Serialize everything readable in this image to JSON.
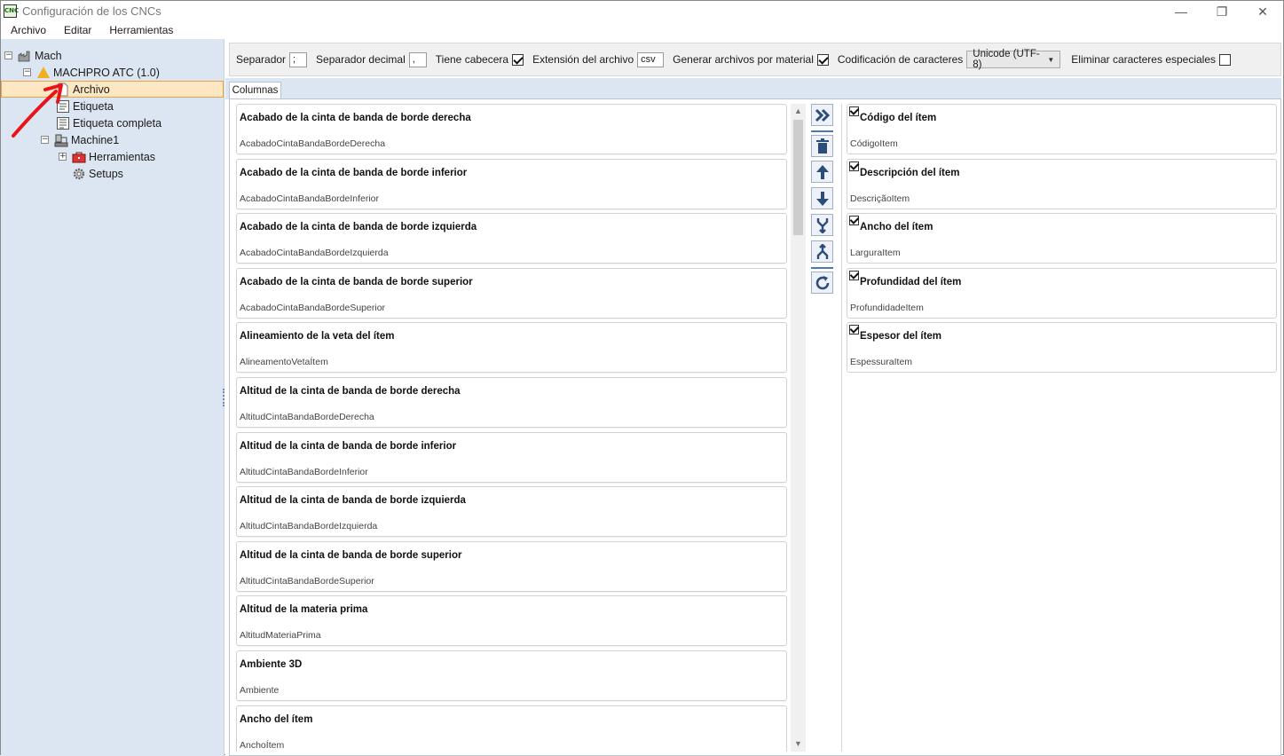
{
  "window": {
    "app_icon_text": "CNC",
    "title": "Configuración de los CNCs",
    "minimize_glyph": "—",
    "restore_glyph": "❐",
    "close_glyph": "✕"
  },
  "menubar": [
    "Archivo",
    "Editar",
    "Herramientas"
  ],
  "tree": {
    "root": "Mach",
    "machine": "MACHPRO ATC (1.0)",
    "archivo": "Archivo",
    "etiqueta": "Etiqueta",
    "etiqueta_completa": "Etiqueta completa",
    "machine1": "Machine1",
    "herramientas": "Herramientas",
    "setups": "Setups",
    "collapse_glyph": "−",
    "expand_glyph": "+"
  },
  "toolbar": {
    "separador_label": "Separador",
    "separador_value": ";",
    "separador_decimal_label": "Separador decimal",
    "separador_decimal_value": ",",
    "tiene_cabecera_label": "Tiene cabecera",
    "tiene_cabecera_checked": true,
    "extension_label": "Extensión del archivo",
    "extension_value": "csv",
    "generar_label": "Generar archivos por material",
    "generar_checked": true,
    "codificacion_label": "Codificación de caracteres",
    "codificacion_value": "Unicode (UTF-8)",
    "eliminar_label": "Eliminar caracteres especiales",
    "eliminar_checked": false
  },
  "tab": {
    "label": "Columnas"
  },
  "available_columns": [
    {
      "title": "Acabado de la cinta de banda de borde derecha",
      "key": "AcabadoCintaBandaBordeDerecha"
    },
    {
      "title": "Acabado de la cinta de banda de borde inferior",
      "key": "AcabadoCintaBandaBordeInferior"
    },
    {
      "title": "Acabado de la cinta de banda de borde izquierda",
      "key": "AcabadoCintaBandaBordeIzquierda"
    },
    {
      "title": "Acabado de la cinta de banda de borde superior",
      "key": "AcabadoCintaBandaBordeSuperior"
    },
    {
      "title": "Alineamiento de la veta del ítem",
      "key": "AlineamentoVetaÍtem"
    },
    {
      "title": "Altitud de la cinta de banda de borde derecha",
      "key": "AltitudCintaBandaBordeDerecha"
    },
    {
      "title": "Altitud de la cinta de banda de borde inferior",
      "key": "AltitudCintaBandaBordeInferior"
    },
    {
      "title": "Altitud de la cinta de banda de borde izquierda",
      "key": "AltitudCintaBandaBordeIzquierda"
    },
    {
      "title": "Altitud de la cinta de banda de borde superior",
      "key": "AltitudCintaBandaBordeSuperior"
    },
    {
      "title": "Altitud de la materia prima",
      "key": "AltitudMateriaPrima"
    },
    {
      "title": "Ambiente 3D",
      "key": "Ambiente"
    },
    {
      "title": "Ancho del ítem",
      "key": "AnchoÍtem"
    }
  ],
  "selected_columns": [
    {
      "title": "Código del ítem",
      "key": "CódigoItem"
    },
    {
      "title": "Descripción del ítem",
      "key": "DescriçãoItem"
    },
    {
      "title": "Ancho del ítem",
      "key": "LarguraItem"
    },
    {
      "title": "Profundidad del ítem",
      "key": "ProfundidadeItem"
    },
    {
      "title": "Espesor del ítem",
      "key": "EspessuraItem"
    }
  ],
  "action_buttons": [
    "add-all",
    "delete",
    "move-up",
    "move-down",
    "merge",
    "split",
    "refresh"
  ],
  "colors": {
    "sidebar_bg": "#dce6f3",
    "selection_bg": "#fde6c2",
    "selection_border": "#e8a34a",
    "accent": "#2b4d7a",
    "annotation_arrow": "#e8141a",
    "warning_triangle": "#f2b01e"
  }
}
